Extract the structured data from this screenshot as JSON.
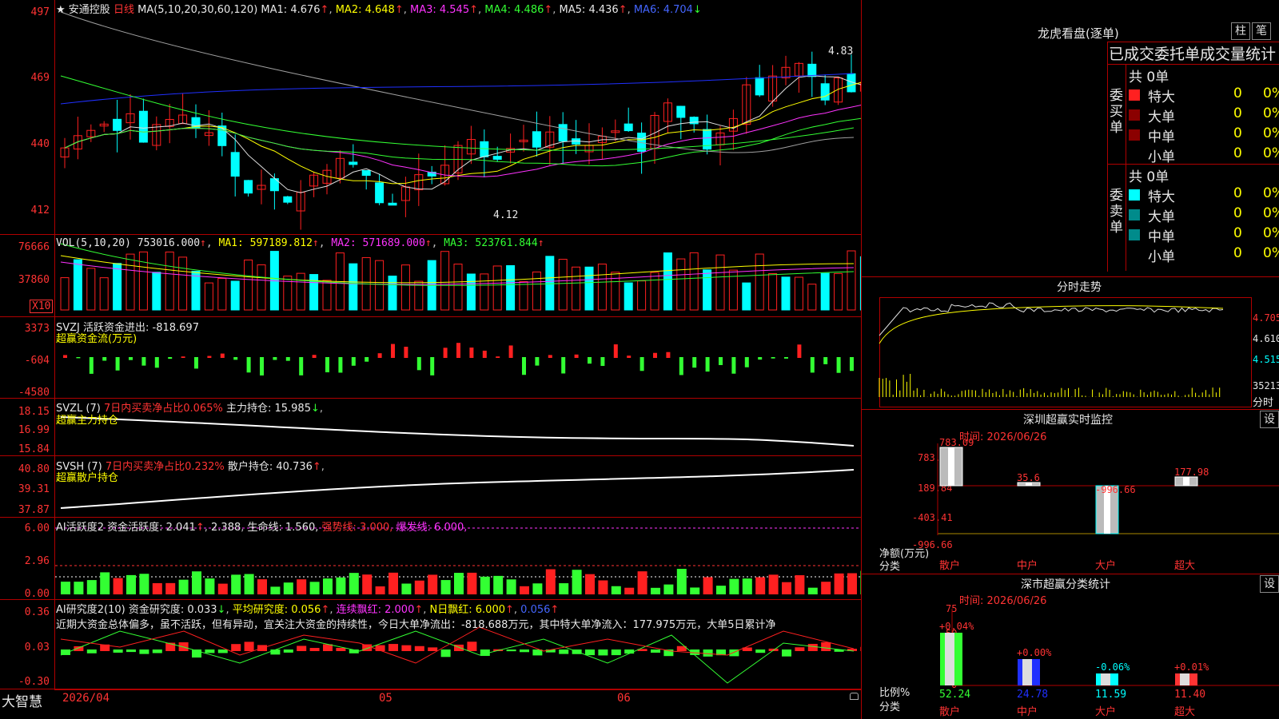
{
  "stock": {
    "star": "★",
    "name": "安通控股",
    "period": "日线"
  },
  "ma_line": {
    "label": "MA(5,10,20,30,60,120)",
    "ma1": "MA1: 4.676",
    "ma2": "MA2: 4.648",
    "ma3": "MA3: 4.545",
    "ma4": "MA4: 4.486",
    "ma5": "MA5: 4.436",
    "ma6": "MA6: 4.704",
    "up": "↑",
    "down": "↓"
  },
  "price_axis": [
    "497",
    "469",
    "440",
    "412"
  ],
  "price_marks": {
    "high": "4.83",
    "low": "4.12"
  },
  "vol_line": {
    "label": "VOL(5,10,20)",
    "vol": "753016.000",
    "ma1": "MA1: 597189.812",
    "ma2": "MA2: 571689.000",
    "ma3": "MA3: 523761.844"
  },
  "vol_axis": [
    "76666",
    "37860"
  ],
  "vol_unit": "X10",
  "svzj": {
    "label": "SVZJ  活跃资金进出: -818.697",
    "sub": "超赢资金流(万元)",
    "axis": [
      "3373",
      "-604",
      "-4580"
    ]
  },
  "svzl": {
    "label": "SVZL (7)",
    "a": "7日内买卖净占比0.065%",
    "b": "主力持仓: 15.985",
    "sub": "超赢主力持仓",
    "axis": [
      "18.15",
      "16.99",
      "15.84"
    ]
  },
  "svsh": {
    "label": "SVSH (7)",
    "a": "7日内买卖净占比0.232%",
    "b": "散户持仓: 40.736",
    "sub": "超赢散户持仓",
    "axis": [
      "40.80",
      "39.31",
      "37.87"
    ]
  },
  "ai1": {
    "label": "AI活跃度2 资金活跃度: 2.041",
    "v2": "2.388",
    "life": "生命线: 1.560,",
    "strong": "强势线: 3.000,",
    "burst": "爆发线: 6.000,",
    "axis": [
      "6.00",
      "2.96",
      "0.00"
    ]
  },
  "ai2": {
    "label": "AI研究度2(10) 资金研究度: 0.033",
    "avg": "平均研究度: 0.056",
    "red": "连续飘红: 2.000",
    "nred": "N日飘红: 6.000",
    "last": "0.056",
    "text": "近期大资金总体偏多，虽不活跃，但有异动，宜关注大资金的持续性，今日大单净流出：-818.688万元，其中特大单净流入：177.975万元，大单5日累计净",
    "axis": [
      "0.36",
      "0.03",
      "-0.30"
    ]
  },
  "bottom": {
    "brand": "大智慧",
    "date": "2026/04",
    "m05": "05",
    "m06": "06"
  },
  "dragon": {
    "title": "龙虎看盘(逐单)",
    "btn1": "柱",
    "btn2": "笔",
    "subtitle": "已成交委托单成交量统计",
    "buy": {
      "side": "委买单",
      "count": "共 0单",
      "rows": [
        {
          "name": "特大",
          "v": "0",
          "p": "0%"
        },
        {
          "name": "大单",
          "v": "0",
          "p": "0%"
        },
        {
          "name": "中单",
          "v": "0",
          "p": "0%"
        },
        {
          "name": "小单",
          "v": "0",
          "p": "0%"
        }
      ]
    },
    "sell": {
      "side": "委卖单",
      "count": "共 0单",
      "rows": [
        {
          "name": "特大",
          "v": "0",
          "p": "0%"
        },
        {
          "name": "大单",
          "v": "0",
          "p": "0%"
        },
        {
          "name": "中单",
          "v": "0",
          "p": "0%"
        },
        {
          "name": "小单",
          "v": "0",
          "p": "0%"
        }
      ]
    }
  },
  "timechart": {
    "title": "分时走势",
    "axis": [
      "4.705",
      "4.610",
      "4.515"
    ],
    "vol": "35213",
    "unit": "分时"
  },
  "monitor": {
    "title": "深圳超赢实时监控",
    "btn": "设",
    "time": "时间: 2026/06/26",
    "axis": [
      "783.09",
      "189.84",
      "-403.41",
      "-996.66"
    ],
    "ylabel1": "净额(万元)",
    "ylabel2": "分类",
    "bars": [
      {
        "cat": "散户",
        "val": "783.09"
      },
      {
        "cat": "中户",
        "val": "35.6"
      },
      {
        "cat": "大户",
        "val": "-996.66"
      },
      {
        "cat": "超大",
        "val": "177.98"
      }
    ]
  },
  "classify": {
    "title": "深市超赢分类统计",
    "btn": "设",
    "time": "时间: 2026/06/26",
    "axis": [
      "75",
      "50",
      "25",
      "0"
    ],
    "ylabel1": "比例%",
    "ylabel2": "分类",
    "bars": [
      {
        "cat": "散户",
        "top": "+0.04%",
        "val": "52.24"
      },
      {
        "cat": "中户",
        "top": "+0.00%",
        "val": "24.78"
      },
      {
        "cat": "大户",
        "top": "-0.06%",
        "val": "11.59"
      },
      {
        "cat": "超大",
        "top": "+0.01%",
        "val": "11.40"
      }
    ]
  },
  "colors": {
    "up": "#ff2020",
    "down": "#00ffff",
    "grid": "#b00000",
    "ma1": "#e0e0e0",
    "ma2": "#ffff00",
    "ma3": "#ff33ff",
    "ma4": "#33ff33",
    "ma5": "#a0a0a0",
    "ma6": "#2030ff"
  }
}
